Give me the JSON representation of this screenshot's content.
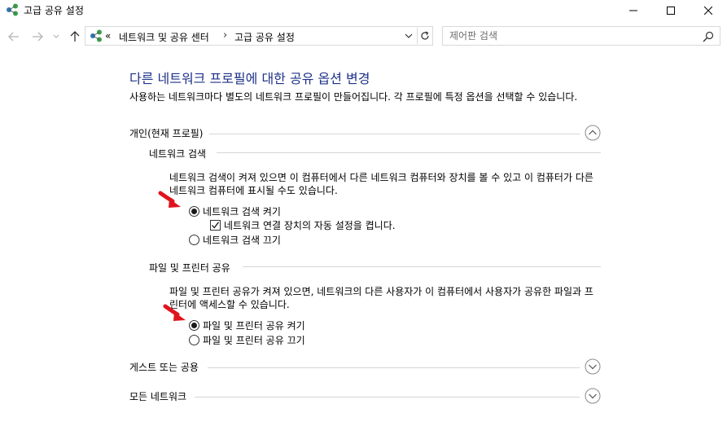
{
  "window": {
    "title": "고급 공유 설정"
  },
  "navigation": {
    "breadcrumb_overflow": "«",
    "breadcrumbs": [
      "네트워크 및 공유 센터",
      "고급 공유 설정"
    ],
    "search_placeholder": "제어판 검색"
  },
  "page": {
    "title": "다른 네트워크 프로필에 대한 공유 옵션 변경",
    "description": "사용하는 네트워크마다 별도의 네트워크 프로필이 만들어집니다. 각 프로필에 특정 옵션을 선택할 수 있습니다."
  },
  "profiles": {
    "private": {
      "label": "개인(현재 프로필)",
      "state": "expanded",
      "network_discovery": {
        "heading": "네트워크 검색",
        "description": "네트워크 검색이 켜져 있으면 이 컴퓨터에서 다른 네트워크 컴퓨터와 장치를 볼 수 있고 이 컴퓨터가 다른 네트워크 컴퓨터에 표시될 수도 있습니다.",
        "option_on": "네트워크 검색 켜기",
        "auto_setup": "네트워크 연결 장치의 자동 설정을 켭니다.",
        "option_off": "네트워크 검색 끄기",
        "selected": "on",
        "auto_setup_checked": true
      },
      "file_sharing": {
        "heading": "파일 및 프린터 공유",
        "description": "파일 및 프린터 공유가 켜져 있으면, 네트워크의 다른 사용자가 이 컴퓨터에서 사용자가 공유한 파일과 프린터에 액세스할 수 있습니다.",
        "option_on": "파일 및 프린터 공유 켜기",
        "option_off": "파일 및 프린터 공유 끄기",
        "selected": "on"
      }
    },
    "guest_public": {
      "label": "게스트 또는 공용",
      "state": "collapsed"
    },
    "all_networks": {
      "label": "모든 네트워크",
      "state": "collapsed"
    }
  },
  "colors": {
    "title_blue": "#1e3287",
    "annotation_red": "#e0141e"
  }
}
